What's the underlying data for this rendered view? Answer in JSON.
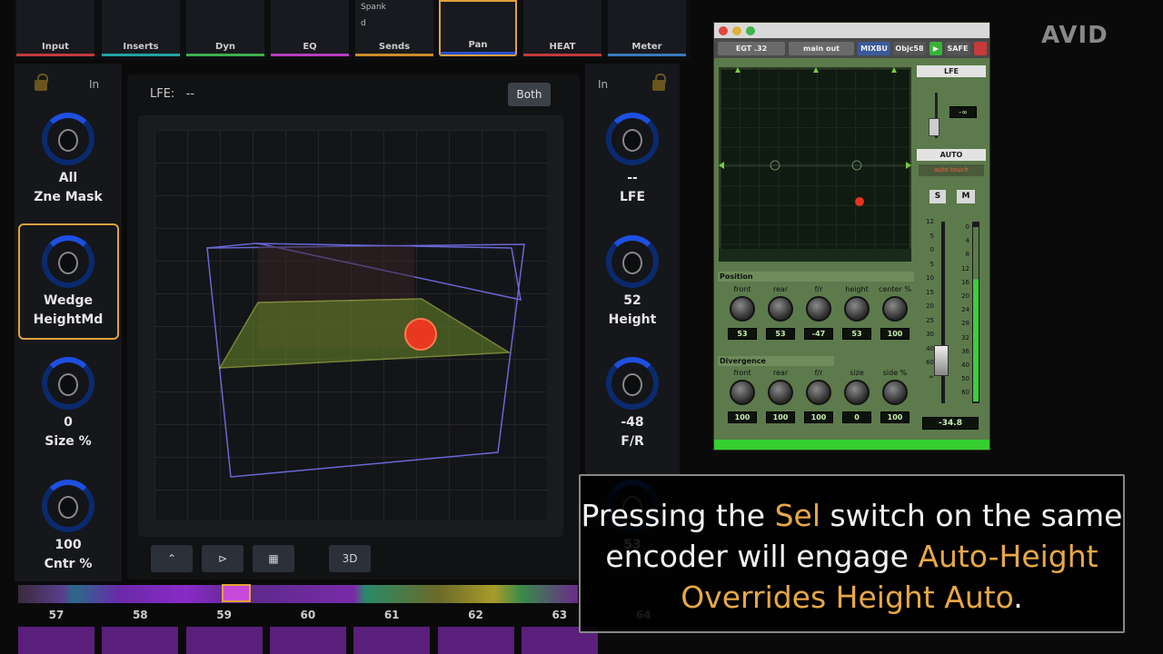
{
  "top_modules": [
    {
      "label": "Input",
      "color": "#c23b3b"
    },
    {
      "label": "Inserts",
      "color": "#22a3a3"
    },
    {
      "label": "Dyn",
      "color": "#3db04a"
    },
    {
      "label": "EQ",
      "color": "#b83cc0"
    },
    {
      "label": "Sends",
      "color": "#d08a2a"
    },
    {
      "label": "Pan",
      "color": "#2a4fd0"
    },
    {
      "label": "HEAT",
      "color": "#c23b3b"
    },
    {
      "label": "Meter",
      "color": "#3a7ac0"
    }
  ],
  "sends_items": [
    "Spank",
    "d"
  ],
  "left_strip": {
    "in_label": "In",
    "knobs": [
      {
        "line1": "All",
        "line2": "Zne Mask"
      },
      {
        "line1": "Wedge",
        "line2": "HeightMd"
      },
      {
        "line1": "0",
        "line2": "Size %"
      },
      {
        "line1": "100",
        "line2": "Cntr %"
      }
    ]
  },
  "right_strip": {
    "in_label": "In",
    "knobs": [
      {
        "line1": "--",
        "line2": "LFE"
      },
      {
        "line1": "52",
        "line2": "Height"
      },
      {
        "line1": "-48",
        "line2": "F/R"
      },
      {
        "line1": "53",
        "line2": ""
      }
    ]
  },
  "center": {
    "lfe_label": "LFE:",
    "lfe_value": "--",
    "both_label": "Both",
    "btn_3d": "3D"
  },
  "channels": [
    "57",
    "58",
    "59",
    "60",
    "61",
    "62",
    "63",
    "64"
  ],
  "plugin": {
    "track": "EGT .32",
    "output": "main out",
    "mixbus": "MIXBU",
    "obj": "Objc58",
    "safe": "SAFE",
    "lfe_header": "LFE",
    "lfe_value": "-∞",
    "auto_header": "AUTO",
    "auto_mode": "auto touch",
    "s": "S",
    "m": "M",
    "position_label": "Position",
    "divergence_label": "Divergence",
    "position": [
      {
        "label": "front",
        "value": "53"
      },
      {
        "label": "rear",
        "value": "53"
      },
      {
        "label": "f/r",
        "value": "-47"
      },
      {
        "label": "height",
        "value": "53"
      },
      {
        "label": "center %",
        "value": "100"
      }
    ],
    "divergence": [
      {
        "label": "front",
        "value": "100"
      },
      {
        "label": "rear",
        "value": "100"
      },
      {
        "label": "f/r",
        "value": "100"
      },
      {
        "label": "size",
        "value": "0"
      },
      {
        "label": "side %",
        "value": "100"
      }
    ],
    "fader_scale": [
      "12",
      "5",
      "0",
      "5",
      "10",
      "15",
      "20",
      "25",
      "30",
      "40",
      "60",
      "∞"
    ],
    "meter_scale": [
      "0",
      "4",
      "8",
      "12",
      "16",
      "20",
      "24",
      "28",
      "32",
      "36",
      "40",
      "50",
      "60"
    ],
    "fader_value": "-34.8"
  },
  "caption": {
    "p1": "Pressing the ",
    "h1": "Sel",
    "p2": " switch on the same encoder will engage ",
    "h2": "Auto-Height Overrides Height Auto",
    "p3": "."
  },
  "brand": "AVID"
}
